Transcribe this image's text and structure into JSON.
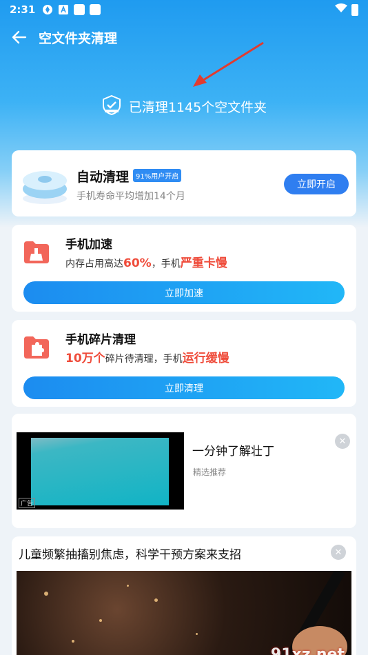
{
  "status_bar": {
    "time": "2:31"
  },
  "header": {
    "title": "空文件夹清理"
  },
  "result": {
    "text": "已清理1145个空文件夹"
  },
  "auto_clean": {
    "title": "自动清理",
    "badge": "91%用户开启",
    "subtitle": "手机寿命平均增加14个月",
    "button": "立即开启"
  },
  "speedup": {
    "title": "手机加速",
    "desc_prefix": "内存占用高达",
    "desc_highlight1": "60%",
    "desc_middle": "，手机",
    "desc_highlight2": "严重卡慢",
    "button": "立即加速"
  },
  "fragment": {
    "title": "手机碎片清理",
    "desc_highlight1": "10万个",
    "desc_middle": "碎片待清理，手机",
    "desc_highlight2": "运行缓慢",
    "button": "立即清理"
  },
  "ad1": {
    "title": "一分钟了解壮丁",
    "subtitle": "精选推荐",
    "tag": "广告"
  },
  "ad2": {
    "title": "儿童频繁抽搐别焦虑，科学干预方案来支招"
  },
  "watermark": "91xz.net",
  "colors": {
    "accent": "#2f7ef0",
    "highlight": "#ef4b3a"
  }
}
